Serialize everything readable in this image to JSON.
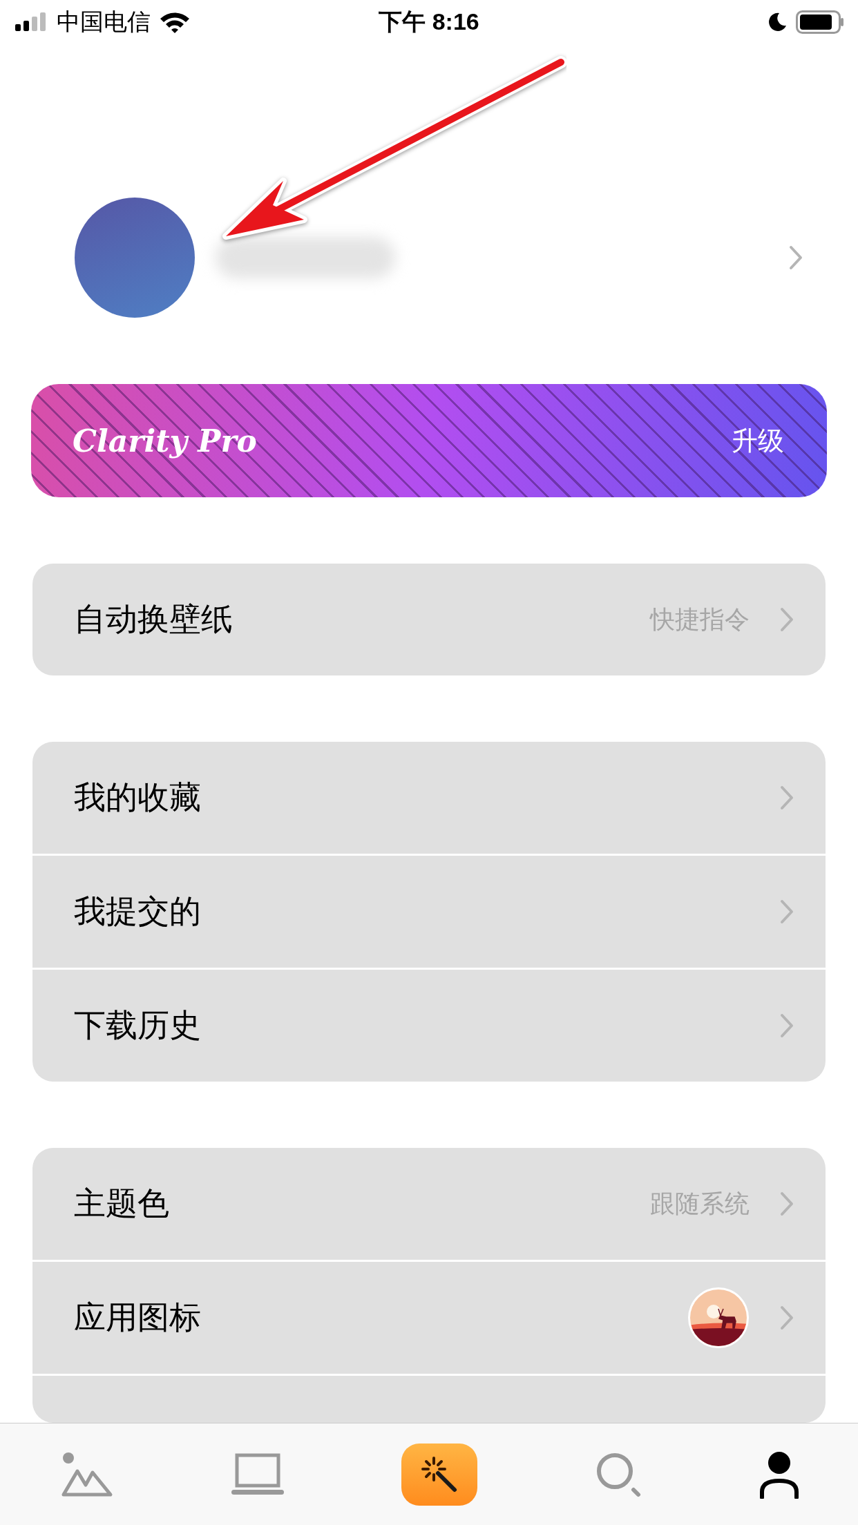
{
  "status_bar": {
    "carrier": "中国电信",
    "time": "下午 8:16"
  },
  "banner": {
    "title": "Clarity Pro",
    "action": "升级"
  },
  "groups": [
    {
      "rows": [
        {
          "kind": "value",
          "label": "自动换壁纸",
          "value": "快捷指令"
        }
      ]
    },
    {
      "rows": [
        {
          "kind": "plain",
          "label": "我的收藏"
        },
        {
          "kind": "plain",
          "label": "我提交的"
        },
        {
          "kind": "plain",
          "label": "下载历史"
        }
      ]
    },
    {
      "rows": [
        {
          "kind": "value",
          "label": "主题色",
          "value": "跟随系统"
        },
        {
          "kind": "icon",
          "label": "应用图标"
        },
        {
          "kind": "partial"
        }
      ]
    }
  ],
  "tabs": [
    {
      "kind": "gallery",
      "selected": false
    },
    {
      "kind": "laptop",
      "selected": false
    },
    {
      "kind": "magic",
      "selected": false
    },
    {
      "kind": "search",
      "selected": false
    },
    {
      "kind": "profile",
      "selected": true
    }
  ]
}
